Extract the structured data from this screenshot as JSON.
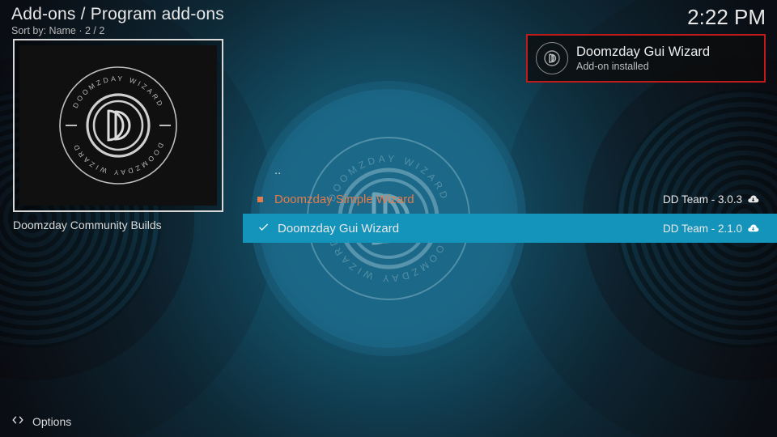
{
  "header": {
    "breadcrumbs": "Add-ons / Program add-ons",
    "sort_line": "Sort by: Name  ·  2 / 2",
    "clock": "2:22 PM"
  },
  "left": {
    "thumb_caption": "Doomzday Community Builds",
    "emblem_top": "DOOMZDAY WIZARD",
    "emblem_bottom": "DOOMZDAY WIZARD",
    "emblem_letter": "D"
  },
  "list": {
    "parent_label": "..",
    "items": [
      {
        "label": "Doomzday Simple Wizard",
        "meta": "DD Team - 3.0.3"
      },
      {
        "label": "Doomzday Gui Wizard",
        "meta": "DD Team - 2.1.0"
      }
    ]
  },
  "toast": {
    "title": "Doomzday Gui Wizard",
    "subtitle": "Add-on installed"
  },
  "footer": {
    "options_label": "Options"
  }
}
